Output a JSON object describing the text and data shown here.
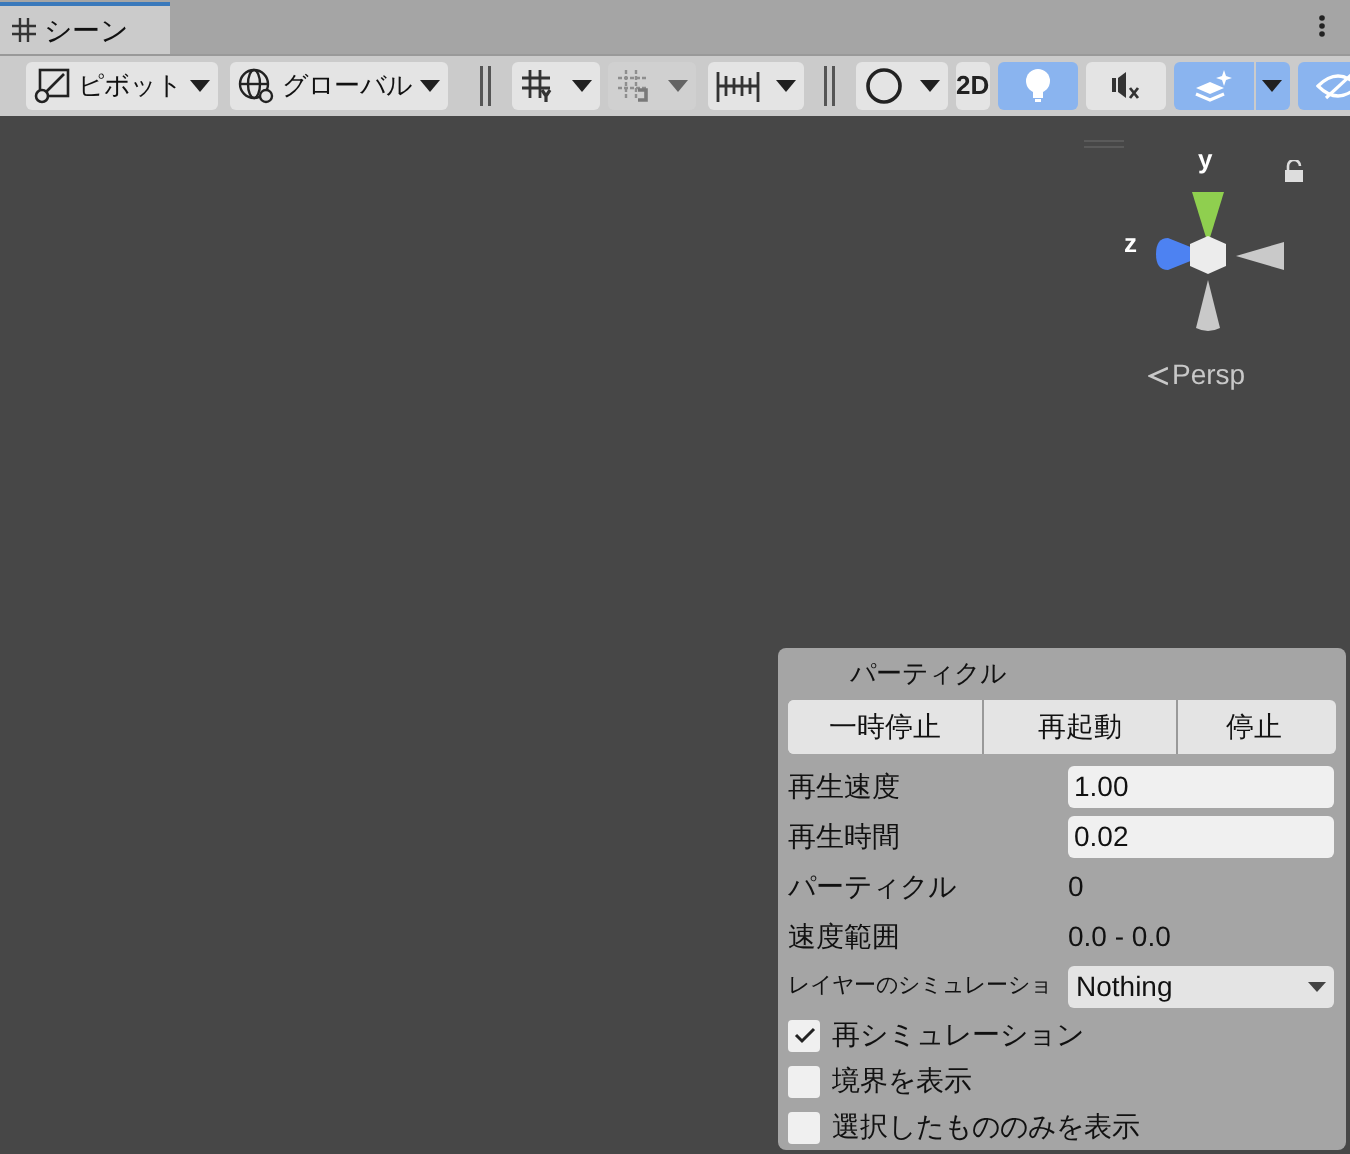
{
  "tab": {
    "title": "シーン",
    "selected": true
  },
  "toolbar": {
    "pivot": "ピボット",
    "global": "グローバル",
    "two_d": {
      "label": "2D",
      "selected": false
    },
    "toggles": [
      {
        "kind": "light",
        "selected": true
      },
      {
        "kind": "audio",
        "selected": false
      },
      {
        "kind": "effects",
        "selected": true
      },
      {
        "kind": "visibility",
        "selected": true
      }
    ]
  },
  "gizmo": {
    "y_label": "y",
    "z_label": "z",
    "projection": "Persp"
  },
  "particle_panel": {
    "title": "パーティクル",
    "buttons": [
      "一時停止",
      "再起動",
      "停止"
    ],
    "fields": [
      {
        "kind": "input",
        "label": "再生速度",
        "value": "1.00"
      },
      {
        "kind": "input",
        "label": "再生時間",
        "value": "0.02"
      },
      {
        "kind": "text",
        "label": "パーティクル",
        "value": "0"
      },
      {
        "kind": "text",
        "label": "速度範囲",
        "value": "0.0 - 0.0"
      },
      {
        "kind": "dropdown",
        "label": "レイヤーのシミュレーショ",
        "value": "Nothing"
      }
    ],
    "checkboxes": [
      {
        "label": "再シミュレーション",
        "checked": true
      },
      {
        "label": "境界を表示",
        "checked": false
      },
      {
        "label": "選択したもののみを表示",
        "checked": false
      }
    ]
  }
}
